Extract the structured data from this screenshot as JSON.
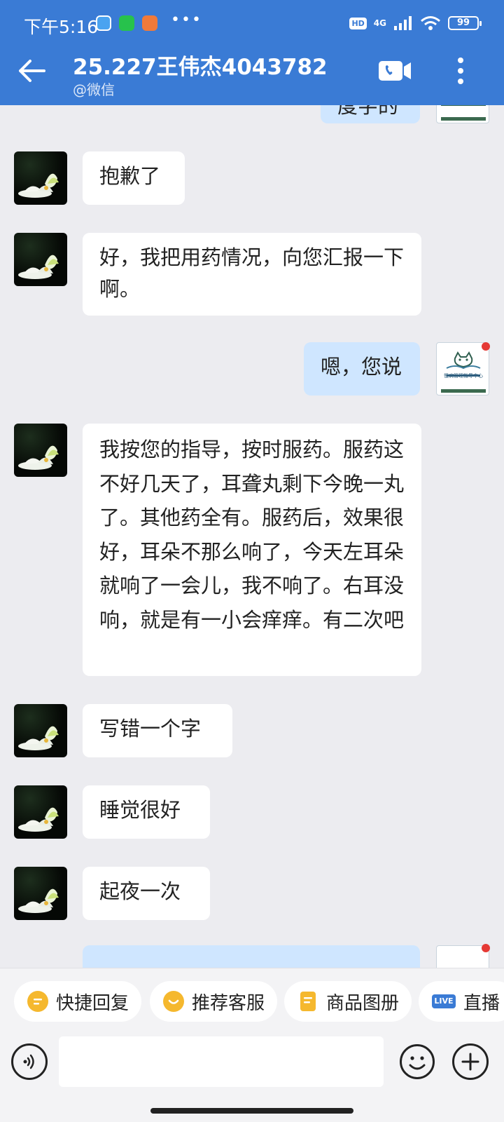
{
  "status_bar": {
    "time": "下午5:16",
    "network": "4G",
    "hd": "HD",
    "battery": "99"
  },
  "header": {
    "title": "25.227王伟杰4043782",
    "subtitle": "@微信",
    "background_color": "#3a7bd5"
  },
  "messages": [
    {
      "side": "out",
      "text": "度字的",
      "partial": true
    },
    {
      "side": "in",
      "text": "抱歉了"
    },
    {
      "side": "in",
      "text": "好，我把用药情况，向您汇报一下啊。"
    },
    {
      "side": "out",
      "text": "嗯，您说"
    },
    {
      "side": "in",
      "text": "我按您的指导，按时服药。服药这不好几天了，耳聋丸剩下今晚一丸了。其他药全有。服药后，效果很好，耳朵不那么响了，今天左耳朵就响了一会儿，我不响了。右耳没响，就是有一小会痒痒。有二次吧"
    },
    {
      "side": "in",
      "text": "写错一个字"
    },
    {
      "side": "in",
      "text": "睡觉很好"
    },
    {
      "side": "in",
      "text": "起夜一次"
    }
  ],
  "agent_avatar": {
    "org_name": "慢病管理指导中心"
  },
  "quick_actions": [
    {
      "label": "快捷回复",
      "icon": "quick-reply-icon"
    },
    {
      "label": "推荐客服",
      "icon": "recommend-service-icon"
    },
    {
      "label": "商品图册",
      "icon": "product-album-icon"
    },
    {
      "label": "直播",
      "icon": "live-icon",
      "badge": "LIVE"
    }
  ],
  "input": {
    "placeholder": ""
  },
  "colors": {
    "incoming_bubble": "#ffffff",
    "outgoing_bubble": "#cfe6ff",
    "chat_background": "#ececf0",
    "unread_dot": "#e53935"
  }
}
